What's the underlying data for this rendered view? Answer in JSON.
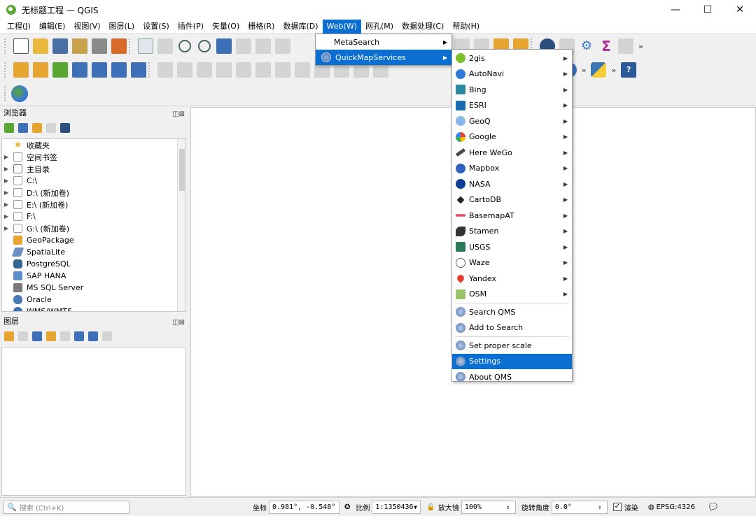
{
  "window": {
    "title": "无标题工程 — QGIS",
    "controls": [
      "—",
      "☐",
      "✕"
    ]
  },
  "menubar": [
    "工程(J)",
    "编辑(E)",
    "视图(V)",
    "图层(L)",
    "设置(S)",
    "插件(P)",
    "矢量(O)",
    "栅格(R)",
    "数据库(D)",
    "Web(W)",
    "网孔(M)",
    "数据处理(C)",
    "帮助(H)"
  ],
  "active_menu_index": 9,
  "web_menu": [
    {
      "label": "MetaSearch",
      "submenu": true
    },
    {
      "label": "QuickMapServices",
      "submenu": true,
      "highlighted": true
    }
  ],
  "qms_menu": {
    "providers": [
      "2gis",
      "AutoNavi",
      "Bing",
      "ESRI",
      "GeoQ",
      "Google",
      "Here WeGo",
      "Mapbox",
      "NASA",
      "CartoDB",
      "BasemapAT",
      "Stamen",
      "USGS",
      "Waze",
      "Yandex",
      "OSM"
    ],
    "provider_icons": [
      "2gis-icon",
      "autonavi-icon",
      "bing-icon",
      "esri-icon",
      "geoq-icon",
      "google-icon",
      "here-wego-icon",
      "mapbox-icon",
      "nasa-icon",
      "cartodb-icon",
      "basemapat-icon",
      "stamen-icon",
      "usgs-icon",
      "waze-icon",
      "yandex-icon",
      "osm-icon"
    ],
    "search_items": [
      "Search QMS",
      "Add to Search"
    ],
    "setting_items": [
      "Set proper scale",
      "Settings",
      "About QMS"
    ],
    "highlighted": "Settings"
  },
  "browser": {
    "title": "浏览器",
    "items": [
      {
        "label": "收藏夹",
        "icon": "star-icon",
        "expandable": false
      },
      {
        "label": "空间书签",
        "icon": "bookmark-icon",
        "expandable": true
      },
      {
        "label": "主目录",
        "icon": "home-icon",
        "expandable": true
      },
      {
        "label": "C:\\",
        "icon": "folder-icon",
        "expandable": true
      },
      {
        "label": "D:\\ (新加卷)",
        "icon": "folder-icon",
        "expandable": true
      },
      {
        "label": "E:\\ (新加卷)",
        "icon": "folder-icon",
        "expandable": true
      },
      {
        "label": "F:\\",
        "icon": "folder-icon",
        "expandable": true
      },
      {
        "label": "G:\\ (新加卷)",
        "icon": "folder-icon",
        "expandable": true
      },
      {
        "label": "GeoPackage",
        "icon": "geopackage-icon",
        "expandable": false
      },
      {
        "label": "SpatiaLite",
        "icon": "spatialite-icon",
        "expandable": false
      },
      {
        "label": "PostgreSQL",
        "icon": "postgresql-icon",
        "expandable": false
      },
      {
        "label": "SAP HANA",
        "icon": "sap-hana-icon",
        "expandable": false
      },
      {
        "label": "MS SQL Server",
        "icon": "mssql-icon",
        "expandable": false
      },
      {
        "label": "Oracle",
        "icon": "oracle-icon",
        "expandable": false
      },
      {
        "label": "WMS/WMTS",
        "icon": "wms-icon",
        "expandable": false
      }
    ]
  },
  "layers": {
    "title": "图层"
  },
  "status": {
    "search_placeholder": "搜索 (Ctrl+K)",
    "coord_label": "坐标",
    "coord_value": "0.981°, -0.548°",
    "scale_label": "比例",
    "scale_value": "1:1350436",
    "magnifier_label": "放大镜",
    "magnifier_value": "100%",
    "rotation_label": "旋转角度",
    "rotation_value": "0.0°",
    "render_label": "渲染",
    "crs": "EPSG:4326"
  },
  "colors": {
    "accent": "#0a6fd1",
    "qgis_green": "#5aa632"
  }
}
